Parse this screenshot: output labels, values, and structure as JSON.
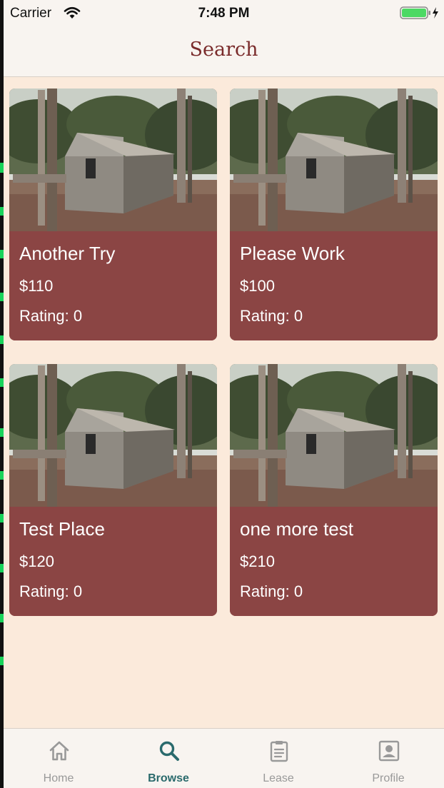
{
  "status_bar": {
    "carrier": "Carrier",
    "time": "7:48 PM"
  },
  "nav": {
    "title": "Search"
  },
  "listings": [
    {
      "name": "Another Try",
      "price": "$110",
      "rating": "Rating: 0"
    },
    {
      "name": "Please Work",
      "price": "$100",
      "rating": "Rating: 0"
    },
    {
      "name": "Test Place",
      "price": "$120",
      "rating": "Rating: 0"
    },
    {
      "name": "one more test",
      "price": "$210",
      "rating": "Rating: 0"
    }
  ],
  "tabs": [
    {
      "label": "Home",
      "icon": "home-icon"
    },
    {
      "label": "Browse",
      "icon": "search-icon",
      "active": true
    },
    {
      "label": "Lease",
      "icon": "clipboard-icon"
    },
    {
      "label": "Profile",
      "icon": "profile-icon"
    }
  ],
  "colors": {
    "background": "#fbeadb",
    "card": "#8b4544",
    "title": "#7a2b2b",
    "tab_active": "#2a6a6c",
    "tab_inactive": "#999999"
  }
}
